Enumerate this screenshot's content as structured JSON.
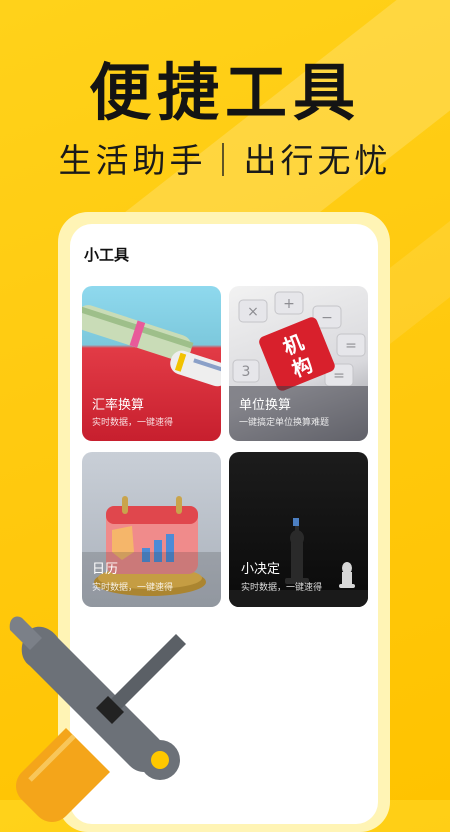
{
  "hero": {
    "title": "便捷工具",
    "subtitle": "生活助手｜出行无忧"
  },
  "section": {
    "title": "小工具"
  },
  "tools": [
    {
      "label": "汇率换算",
      "desc": "实时数据，一键速得",
      "icon": "banknote-roll-image"
    },
    {
      "label": "单位换算",
      "desc": "一键搞定单位换算难题",
      "icon": "calculator-keys-image"
    },
    {
      "label": "日历",
      "desc": "实时数据，一键速得",
      "icon": "calendar-3d-image"
    },
    {
      "label": "小决定",
      "desc": "实时数据，一键速得",
      "icon": "chess-pieces-image"
    }
  ],
  "calculator_key_text": "机构",
  "colors": {
    "background": "#ffc800",
    "text_dark": "#141414",
    "card_white": "#ffffff"
  }
}
